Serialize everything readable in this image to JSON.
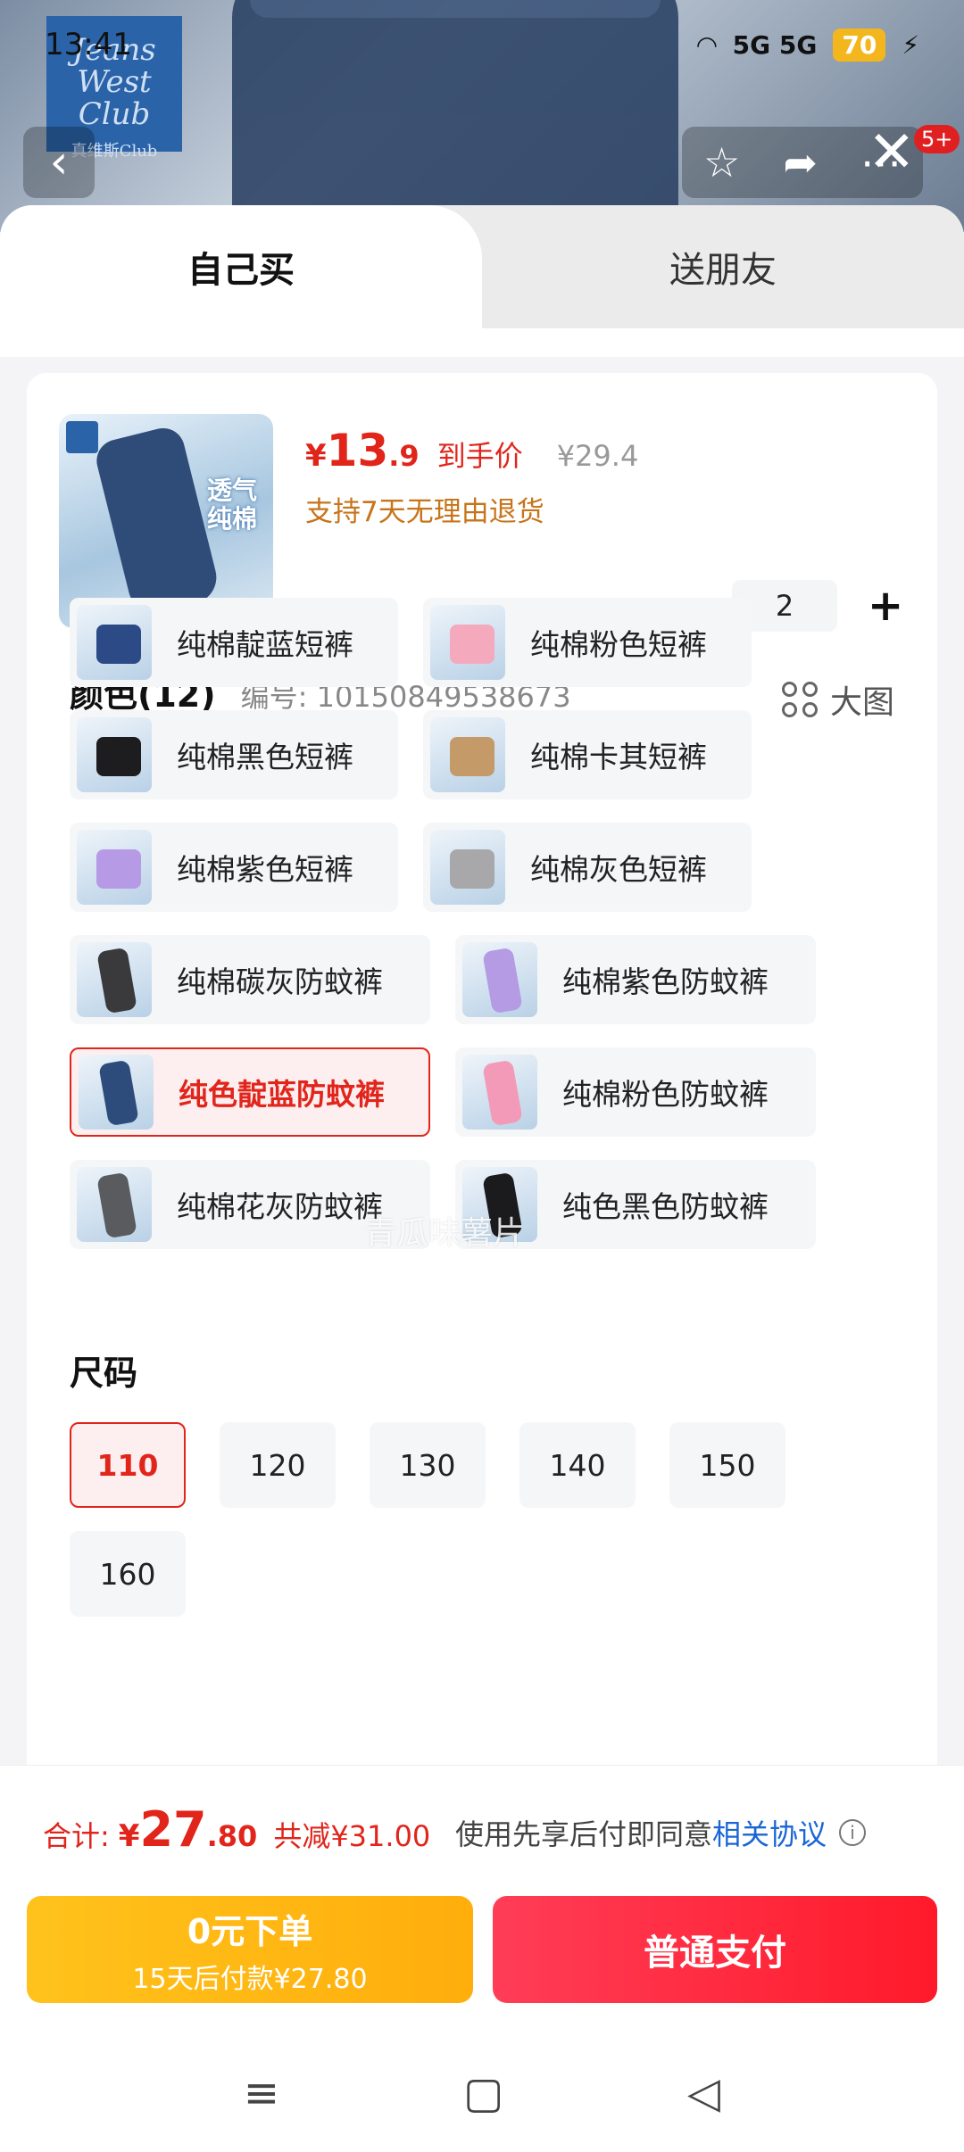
{
  "status": {
    "time": "13:41",
    "network": "5G 5G",
    "battery": "70"
  },
  "header_bg": {
    "brand_logo_text": "Jeans West Club",
    "brand_logo_sub": "真维斯Club",
    "notification_count": "5+"
  },
  "tabs": [
    {
      "label": "自己买",
      "active": true
    },
    {
      "label": "送朋友",
      "active": false
    }
  ],
  "product": {
    "thumb_text": "透气纯棉",
    "price_symbol": "¥",
    "price_int": "13",
    "price_dec": ".9",
    "price_label": "到手价",
    "original_price": "¥29.4",
    "return_policy": "支持7天无理由退货",
    "quantity": "2",
    "qty_minus": "−",
    "qty_plus": "+"
  },
  "color_section": {
    "title": "颜色(12)",
    "code": "编号: 10150849538673",
    "big_image_label": "大图",
    "options": [
      {
        "label": "纯棉靛蓝短裤",
        "swatch": "#2c4a86",
        "style": "short",
        "selected": false
      },
      {
        "label": "纯棉粉色短裤",
        "swatch": "#f5a9bd",
        "style": "short",
        "selected": false
      },
      {
        "label": "纯棉黑色短裤",
        "swatch": "#1d1d1f",
        "style": "short",
        "selected": false
      },
      {
        "label": "纯棉卡其短裤",
        "swatch": "#c39a68",
        "style": "short",
        "selected": false
      },
      {
        "label": "纯棉紫色短裤",
        "swatch": "#b69ae6",
        "style": "short",
        "selected": false
      },
      {
        "label": "纯棉灰色短裤",
        "swatch": "#a8a8aa",
        "style": "short",
        "selected": false
      },
      {
        "label": "纯棉碳灰防蚊裤",
        "swatch": "#3a3a3c",
        "style": "long",
        "selected": false
      },
      {
        "label": "纯棉紫色防蚊裤",
        "swatch": "#b59ae4",
        "style": "long",
        "selected": false
      },
      {
        "label": "纯色靛蓝防蚊裤",
        "swatch": "#2d4c7c",
        "style": "long",
        "selected": true
      },
      {
        "label": "纯棉粉色防蚊裤",
        "swatch": "#f39ab8",
        "style": "long",
        "selected": false
      },
      {
        "label": "纯棉花灰防蚊裤",
        "swatch": "#5a5b5e",
        "style": "long",
        "selected": false
      },
      {
        "label": "纯色黑色防蚊裤",
        "swatch": "#1b1b1d",
        "style": "long",
        "selected": false
      }
    ]
  },
  "size_section": {
    "title": "尺码",
    "sizes": [
      {
        "label": "110",
        "selected": true
      },
      {
        "label": "120",
        "selected": false
      },
      {
        "label": "130",
        "selected": false
      },
      {
        "label": "140",
        "selected": false
      },
      {
        "label": "150",
        "selected": false
      },
      {
        "label": "160",
        "selected": false
      }
    ]
  },
  "watermark": "青瓜味薯片",
  "footer": {
    "total_label": "合计:",
    "total_symbol": "¥",
    "total_int": "27",
    "total_dec": ".80",
    "savings": "共减¥31.00",
    "agree_text": "使用先享后付即同意",
    "agree_link": "相关协议",
    "pay_later_title": "0元下单",
    "pay_later_sub": "15天后付款¥27.80",
    "pay_now": "普通支付"
  },
  "colors": {
    "accent_red": "#e1251b",
    "pay_later_yellow": "#ffb812",
    "link_blue": "#1a66d6"
  }
}
